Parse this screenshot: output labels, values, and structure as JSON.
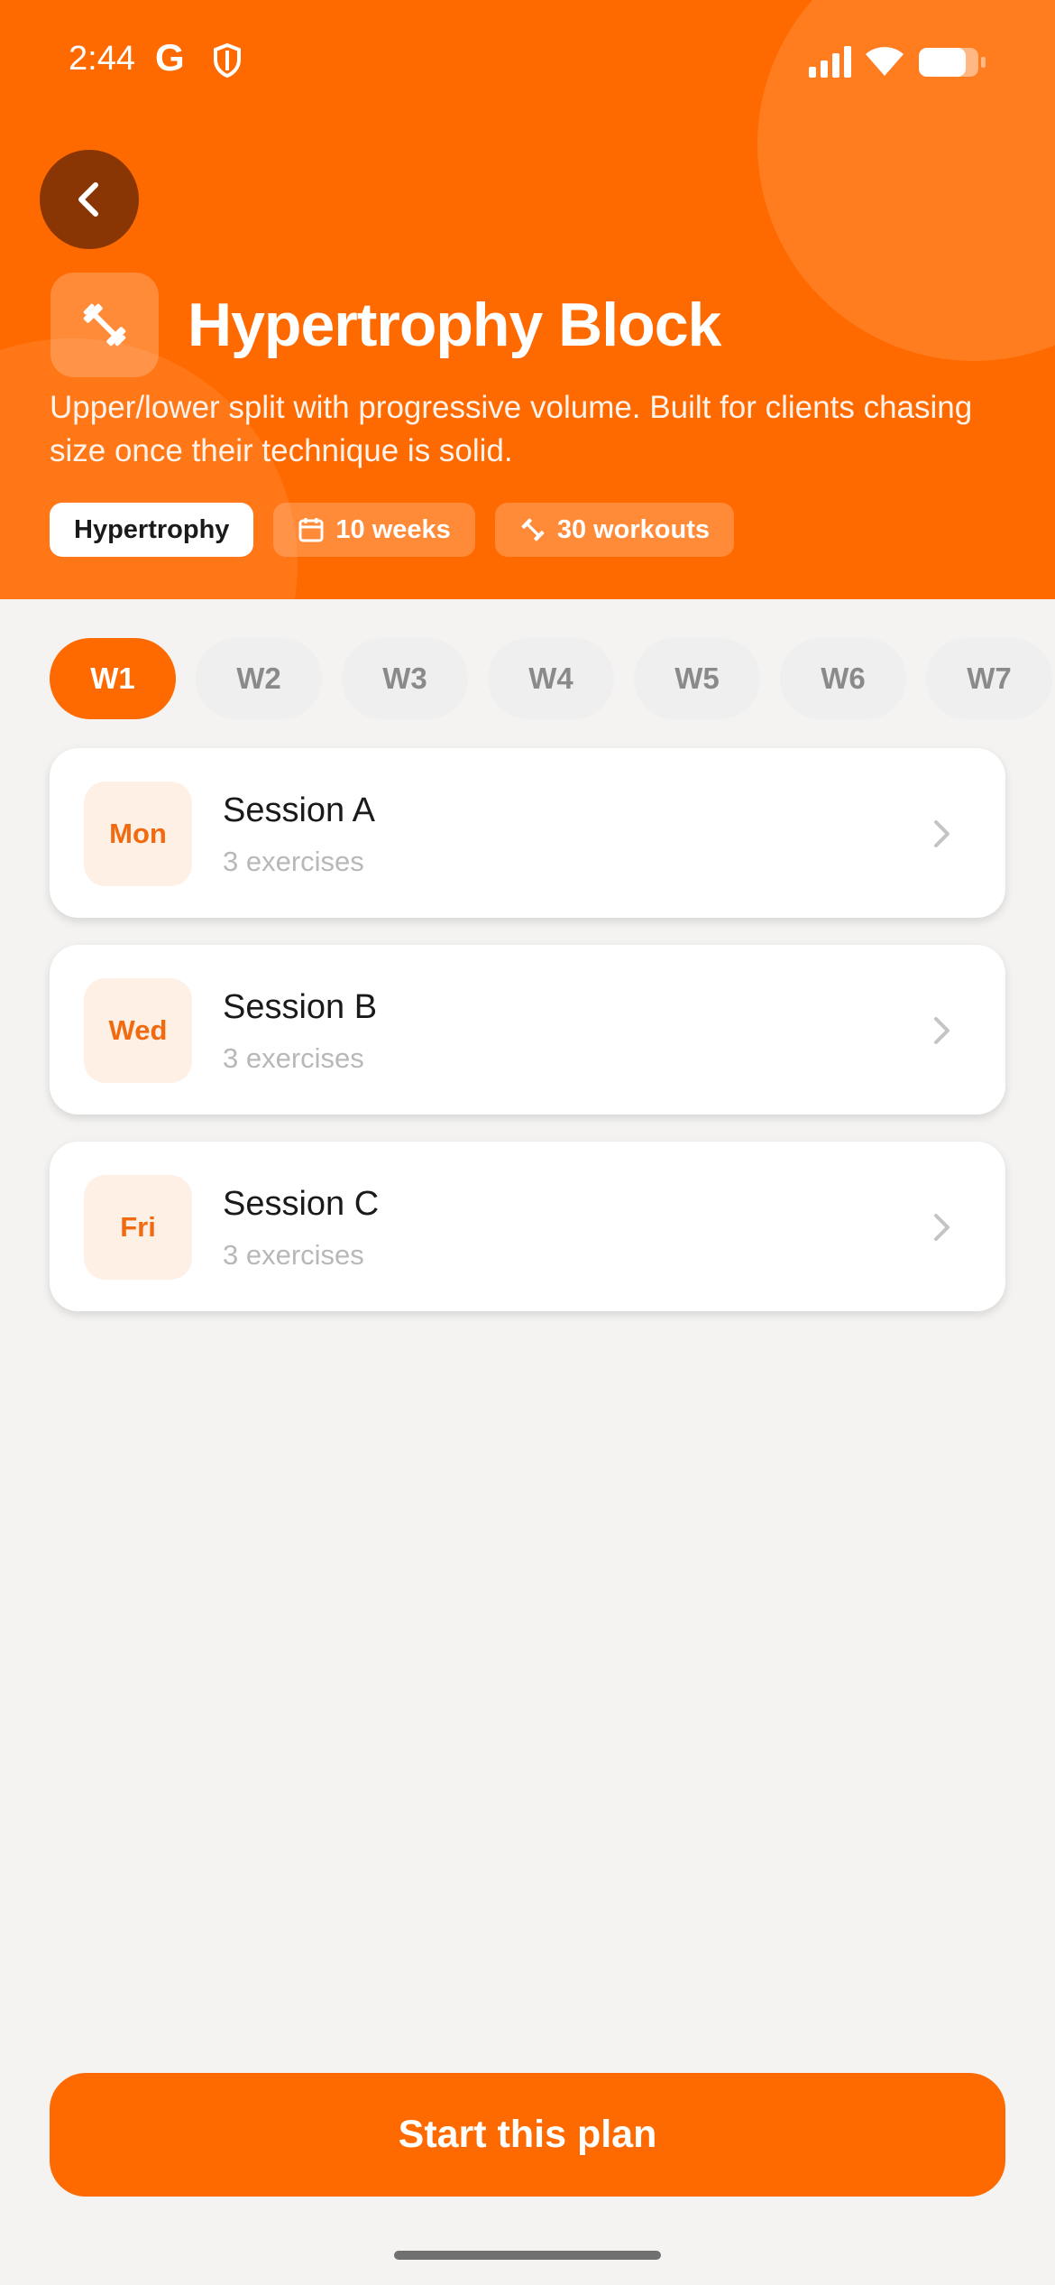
{
  "status_bar": {
    "time": "2:44",
    "g_logo": "G"
  },
  "header": {
    "back_icon": "chevron-left-icon",
    "plan_icon": "dumbbell-icon",
    "title": "Hypertrophy Block",
    "description": "Upper/lower split with progressive volume. Built for clients chasing size once their technique is solid.",
    "tags": [
      {
        "label": "Hypertrophy"
      },
      {
        "label": "10 weeks",
        "icon": "calendar-icon"
      },
      {
        "label": "30 workouts",
        "icon": "dumbbell-icon"
      }
    ]
  },
  "weeks": [
    "W1",
    "W2",
    "W3",
    "W4",
    "W5",
    "W6",
    "W7"
  ],
  "active_week": "W1",
  "sessions": [
    {
      "day": "Mon",
      "name": "Session A",
      "count": "3 exercises"
    },
    {
      "day": "Wed",
      "name": "Session B",
      "count": "3 exercises"
    },
    {
      "day": "Fri",
      "name": "Session C",
      "count": "3 exercises"
    }
  ],
  "cta": {
    "label": "Start this plan"
  },
  "colors": {
    "accent": "#ff6a00",
    "back_button": "#8a3604",
    "day_badge_bg": "#fff0e6",
    "day_badge_text": "#f26a10"
  }
}
